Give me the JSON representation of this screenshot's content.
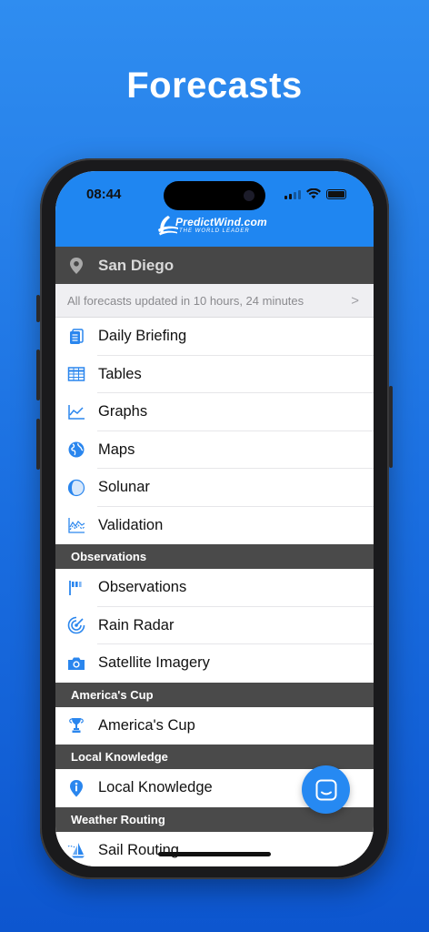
{
  "headline": "Forecasts",
  "status_bar": {
    "time": "08:44"
  },
  "app_header": {
    "brand": "PredictWind.com",
    "tagline": "THE WORLD LEADER"
  },
  "location": {
    "city": "San Diego",
    "icon": "location-pin-icon"
  },
  "update_notice": {
    "text": "All forecasts updated in 10 hours, 24 minutes",
    "chevron": ">"
  },
  "forecast_items": [
    {
      "label": "Daily Briefing",
      "icon": "document-icon"
    },
    {
      "label": "Tables",
      "icon": "table-icon"
    },
    {
      "label": "Graphs",
      "icon": "line-chart-icon"
    },
    {
      "label": "Maps",
      "icon": "globe-icon"
    },
    {
      "label": "Solunar",
      "icon": "moon-phase-icon"
    },
    {
      "label": "Validation",
      "icon": "validation-chart-icon"
    }
  ],
  "sections": {
    "observations": {
      "header": "Observations",
      "items": [
        {
          "label": "Observations",
          "icon": "flag-icon"
        },
        {
          "label": "Rain Radar",
          "icon": "radar-icon"
        },
        {
          "label": "Satellite Imagery",
          "icon": "camera-icon"
        }
      ]
    },
    "americas_cup": {
      "header": "America's Cup",
      "items": [
        {
          "label": "America's Cup",
          "icon": "trophy-icon"
        }
      ]
    },
    "local_knowledge": {
      "header": "Local Knowledge",
      "items": [
        {
          "label": "Local Knowledge",
          "icon": "info-pin-icon"
        }
      ]
    },
    "weather_routing": {
      "header": "Weather Routing",
      "items": [
        {
          "label": "Sail Routing",
          "icon": "sailboat-icon"
        }
      ]
    }
  },
  "colors": {
    "accent": "#1f86f1",
    "icon_blue": "#2a86ee",
    "section_bg": "#4a4a4a",
    "location_bg": "#474747",
    "background_top": "#2f8df0",
    "background_bottom": "#0d56cf"
  }
}
